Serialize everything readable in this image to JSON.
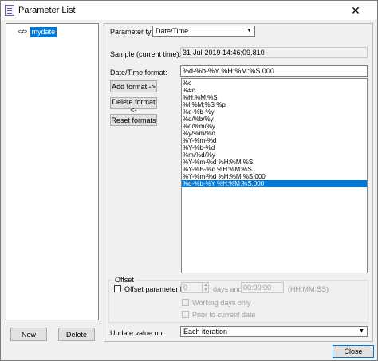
{
  "window": {
    "title": "Parameter List",
    "close_glyph": "✕"
  },
  "tree": {
    "node_glyph": "<#>",
    "items": [
      {
        "label": "mydate",
        "selected": true
      }
    ]
  },
  "left_buttons": {
    "new_label": "New",
    "delete_label": "Delete"
  },
  "param_type": {
    "label": "Parameter type:",
    "value": "Date/Time"
  },
  "sample": {
    "label": "Sample (current time):",
    "value": "31-Jul-2019 14:46:09.810"
  },
  "format": {
    "label": "Date/Time format:",
    "value": "%d-%b-%Y %H:%M:%S.000"
  },
  "format_buttons": {
    "add_label": "Add format ->",
    "delete_label": "Delete format <-",
    "reset_label": "Reset formats"
  },
  "format_list": [
    "%c",
    "%#c",
    "%H:%M:%S",
    "%I:%M:%S %p",
    "%d-%b-%y",
    "%d/%b/%y",
    "%d/%m/%y",
    "%y/%m/%d",
    "%Y-%m-%d",
    "%Y-%b-%d",
    "%m/%d/%y",
    "%Y-%m-%d %H:%M:%S",
    "%Y-%B-%d %H:%M:%S",
    "%Y-%m-%d %H:%M:%S.000",
    "%d-%b-%Y %H:%M:%S.000"
  ],
  "format_list_selected_index": 14,
  "offset": {
    "group_title": "Offset",
    "checkbox_label": "Offset parameter by:",
    "days_value": "0",
    "days_label": "days and",
    "time_value": "00:00:00",
    "time_hint": "(HH:MM:SS)",
    "working_days_label": "Working days only",
    "prior_label": "Prior to current date"
  },
  "update": {
    "label": "Update value on:",
    "value": "Each iteration"
  },
  "close_button_label": "Close"
}
